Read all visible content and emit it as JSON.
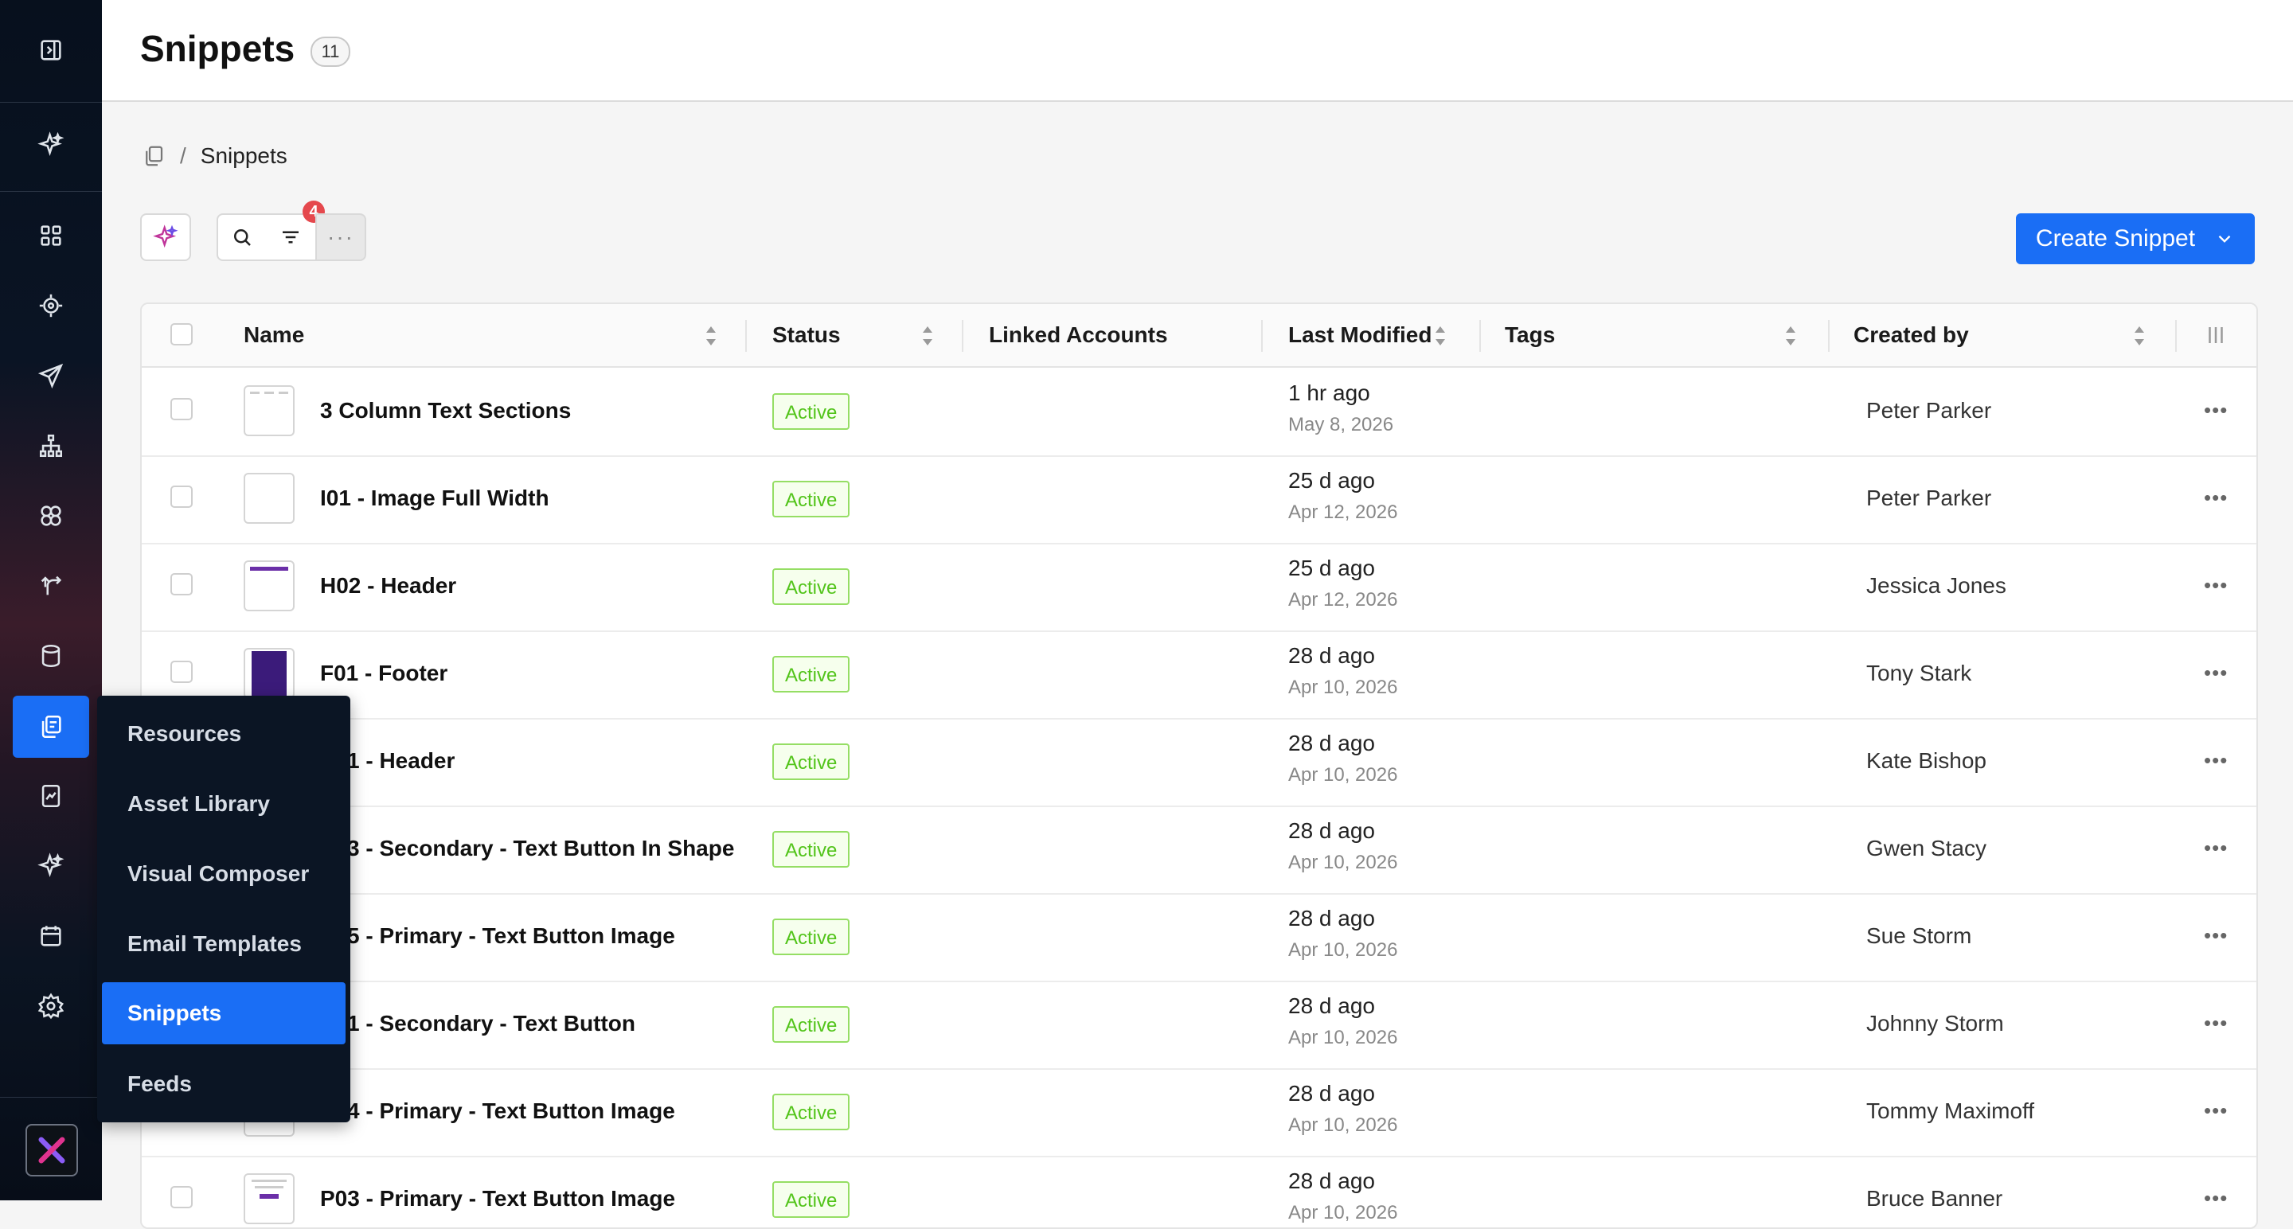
{
  "header": {
    "title": "Snippets",
    "count": "11"
  },
  "breadcrumb": {
    "current": "Snippets",
    "separator": "/"
  },
  "toolbar": {
    "filter_count": "4",
    "more_label": "···",
    "create_label": "Create Snippet"
  },
  "table": {
    "columns": {
      "name": "Name",
      "status": "Status",
      "linked": "Linked Accounts",
      "modified": "Last Modified",
      "tags": "Tags",
      "created": "Created by"
    },
    "rows": [
      {
        "name": "3 Column Text Sections",
        "status": "Active",
        "modified_rel": "1 hr ago",
        "modified_abs": "May 8, 2026",
        "created_by": "Peter Parker",
        "thumb": "columns"
      },
      {
        "name": "I01 - Image Full Width",
        "status": "Active",
        "modified_rel": "25 d ago",
        "modified_abs": "Apr 12, 2026",
        "created_by": "Peter Parker",
        "thumb": "blank"
      },
      {
        "name": "H02 - Header",
        "status": "Active",
        "modified_rel": "25 d ago",
        "modified_abs": "Apr 12, 2026",
        "created_by": "Jessica Jones",
        "thumb": "header"
      },
      {
        "name": "F01 - Footer",
        "status": "Active",
        "modified_rel": "28 d ago",
        "modified_abs": "Apr 10, 2026",
        "created_by": "Tony Stark",
        "thumb": "footer"
      },
      {
        "name": "1 - Header",
        "status": "Active",
        "modified_rel": "28 d ago",
        "modified_abs": "Apr 10, 2026",
        "created_by": "Kate Bishop",
        "thumb": "blank"
      },
      {
        "name": "3 - Secondary - Text Button In Shape",
        "status": "Active",
        "modified_rel": "28 d ago",
        "modified_abs": "Apr 10, 2026",
        "created_by": "Gwen Stacy",
        "thumb": "blank"
      },
      {
        "name": "5 - Primary - Text Button Image",
        "status": "Active",
        "modified_rel": "28 d ago",
        "modified_abs": "Apr 10, 2026",
        "created_by": "Sue Storm",
        "thumb": "blank"
      },
      {
        "name": "1 - Secondary - Text Button",
        "status": "Active",
        "modified_rel": "28 d ago",
        "modified_abs": "Apr 10, 2026",
        "created_by": "Johnny Storm",
        "thumb": "blank"
      },
      {
        "name": "4 - Primary - Text Button Image",
        "status": "Active",
        "modified_rel": "28 d ago",
        "modified_abs": "Apr 10, 2026",
        "created_by": "Tommy Maximoff",
        "thumb": "blank"
      },
      {
        "name": "P03 - Primary - Text Button Image",
        "status": "Active",
        "modified_rel": "28 d ago",
        "modified_abs": "Apr 10, 2026",
        "created_by": "Bruce Banner",
        "thumb": "button"
      }
    ]
  },
  "flyout": {
    "items": [
      "Resources",
      "Asset Library",
      "Visual Composer",
      "Email Templates",
      "Snippets",
      "Feeds"
    ],
    "active": "Snippets"
  },
  "rail_icons": [
    "sidebar-toggle-icon",
    "sparkle-icon",
    "dashboard-grid-icon",
    "target-icon",
    "send-icon",
    "org-chart-icon",
    "segments-icon",
    "journey-icon",
    "database-icon",
    "resources-icon",
    "reports-icon",
    "ai-sparkle-icon",
    "calendar-icon",
    "settings-icon"
  ],
  "colors": {
    "accent": "#1a6ef5",
    "status_active": "#52c41a",
    "badge_red": "#e5484d",
    "rail_bg": "#0a1424"
  }
}
